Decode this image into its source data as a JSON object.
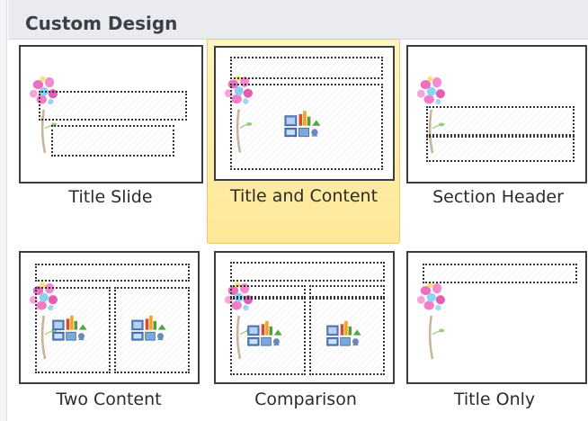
{
  "gallery": {
    "header_title": "Custom Design",
    "layouts": [
      {
        "label": "Title Slide",
        "selected": false
      },
      {
        "label": "Title and Content",
        "selected": true
      },
      {
        "label": "Section Header",
        "selected": false
      },
      {
        "label": "Two Content",
        "selected": false
      },
      {
        "label": "Comparison",
        "selected": false
      },
      {
        "label": "Title Only",
        "selected": false
      }
    ]
  },
  "icons": {
    "decoration": "flower-decoration-icon",
    "content_placeholder": "content-placeholder-icon"
  },
  "colors": {
    "header_bg": "#e9ebef",
    "selection_highlight": "#fde895",
    "selection_border": "#e8c86c",
    "thumbnail_border": "#3d3d3d"
  }
}
